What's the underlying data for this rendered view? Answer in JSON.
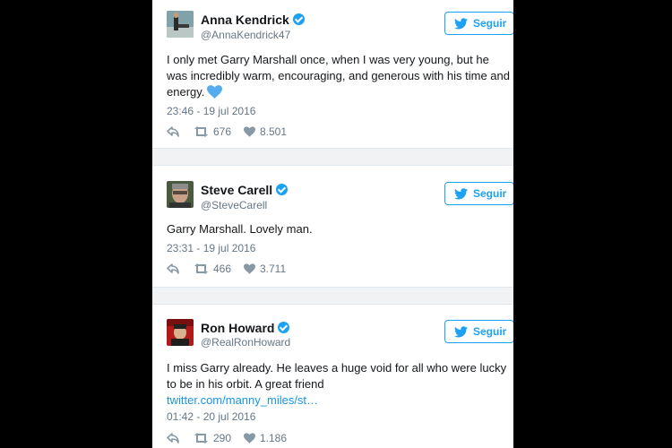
{
  "tweets": [
    {
      "name": "Anna Kendrick",
      "handle": "@AnnaKendrick47",
      "follow_label": "Seguir",
      "text": "I only met Garry Marshall once, when I was very young, but he was incredibly warm, encouraging, and generous with his time and energy.",
      "emoji": "blue-heart",
      "time": "23:46 - 19 jul 2016",
      "retweets": "676",
      "likes": "8.501"
    },
    {
      "name": "Steve Carell",
      "handle": "@SteveCarell",
      "follow_label": "Seguir",
      "text": "Garry Marshall. Lovely man.",
      "time": "23:31 - 19 jul 2016",
      "retweets": "466",
      "likes": "3.711"
    },
    {
      "name": "Ron Howard",
      "handle": "@RealRonHoward",
      "follow_label": "Seguir",
      "text": "I miss Garry already. He leaves a huge void for all who were lucky to be in his orbit. A great friend",
      "link": "twitter.com/manny_miles/st…",
      "time": "01:42 - 20 jul 2016",
      "retweets": "290",
      "likes": "1.186"
    }
  ],
  "icons": {
    "reply": "reply-icon",
    "retweet": "retweet-icon",
    "like": "heart-icon",
    "verified": "verified-badge-icon",
    "follow": "twitter-bird-icon"
  },
  "colors": {
    "accent": "#1da1f2",
    "link": "#1b95e0",
    "text": "#14171a",
    "muted": "#657786",
    "background": "#000000",
    "card": "#ffffff"
  }
}
